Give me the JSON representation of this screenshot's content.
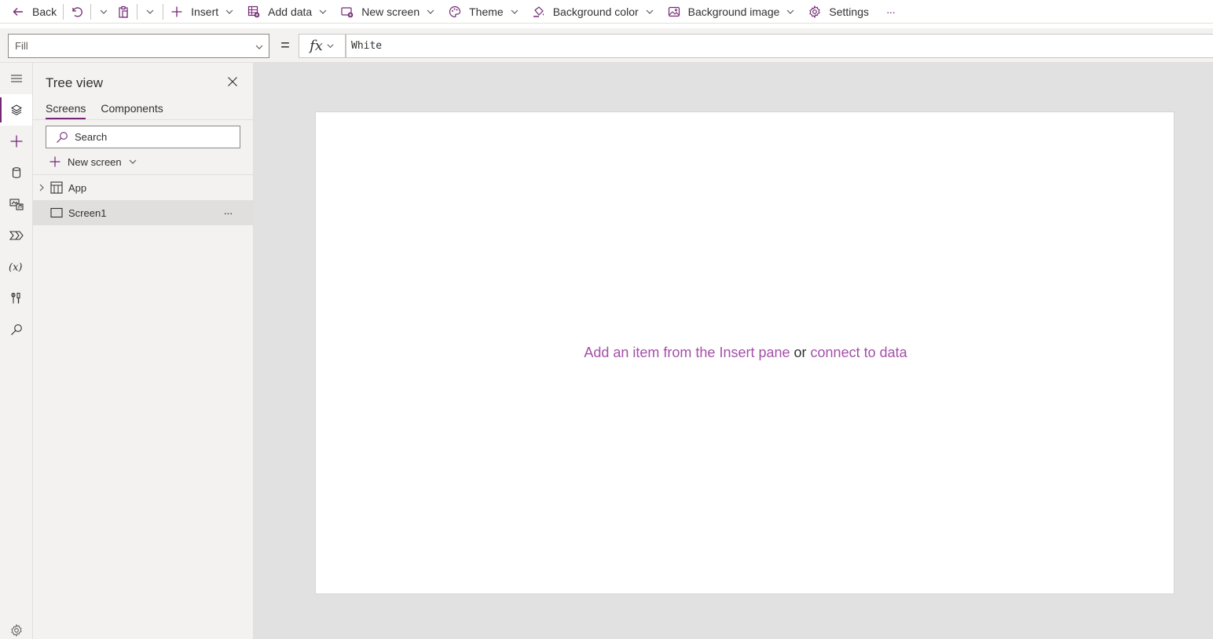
{
  "commandbar": {
    "back_label": "Back",
    "insert_label": "Insert",
    "add_data_label": "Add data",
    "new_screen_label": "New screen",
    "theme_label": "Theme",
    "background_color_label": "Background color",
    "background_image_label": "Background image",
    "settings_label": "Settings",
    "more_label": "···"
  },
  "formulabar": {
    "property": "Fill",
    "equals": "=",
    "fx_label": "fx",
    "formula": "White"
  },
  "tree": {
    "title": "Tree view",
    "tabs": [
      {
        "label": "Screens",
        "active": true
      },
      {
        "label": "Components",
        "active": false
      }
    ],
    "search": {
      "placeholder": "Search",
      "value": ""
    },
    "new_screen_label": "New screen",
    "nodes": [
      {
        "label": "App",
        "selected": false
      },
      {
        "label": "Screen1",
        "selected": true
      }
    ],
    "node_more_label": "···"
  },
  "canvas": {
    "hint_link_1": "Add an item from the Insert pane",
    "hint_middle": " or ",
    "hint_link_2": "connect to data"
  },
  "colors": {
    "accent": "#742774",
    "link": "#a44fa8",
    "canvas_bg": "#e1e1e1",
    "panel_bg": "#f3f2f1",
    "selected_row": "#e1dfdd"
  },
  "rail_icons": [
    "hamburger-icon",
    "tree-view-icon",
    "insert-icon",
    "data-icon",
    "media-icon",
    "power-automate-icon",
    "variables-icon",
    "advanced-tools-icon",
    "search-icon",
    "settings-icon"
  ]
}
